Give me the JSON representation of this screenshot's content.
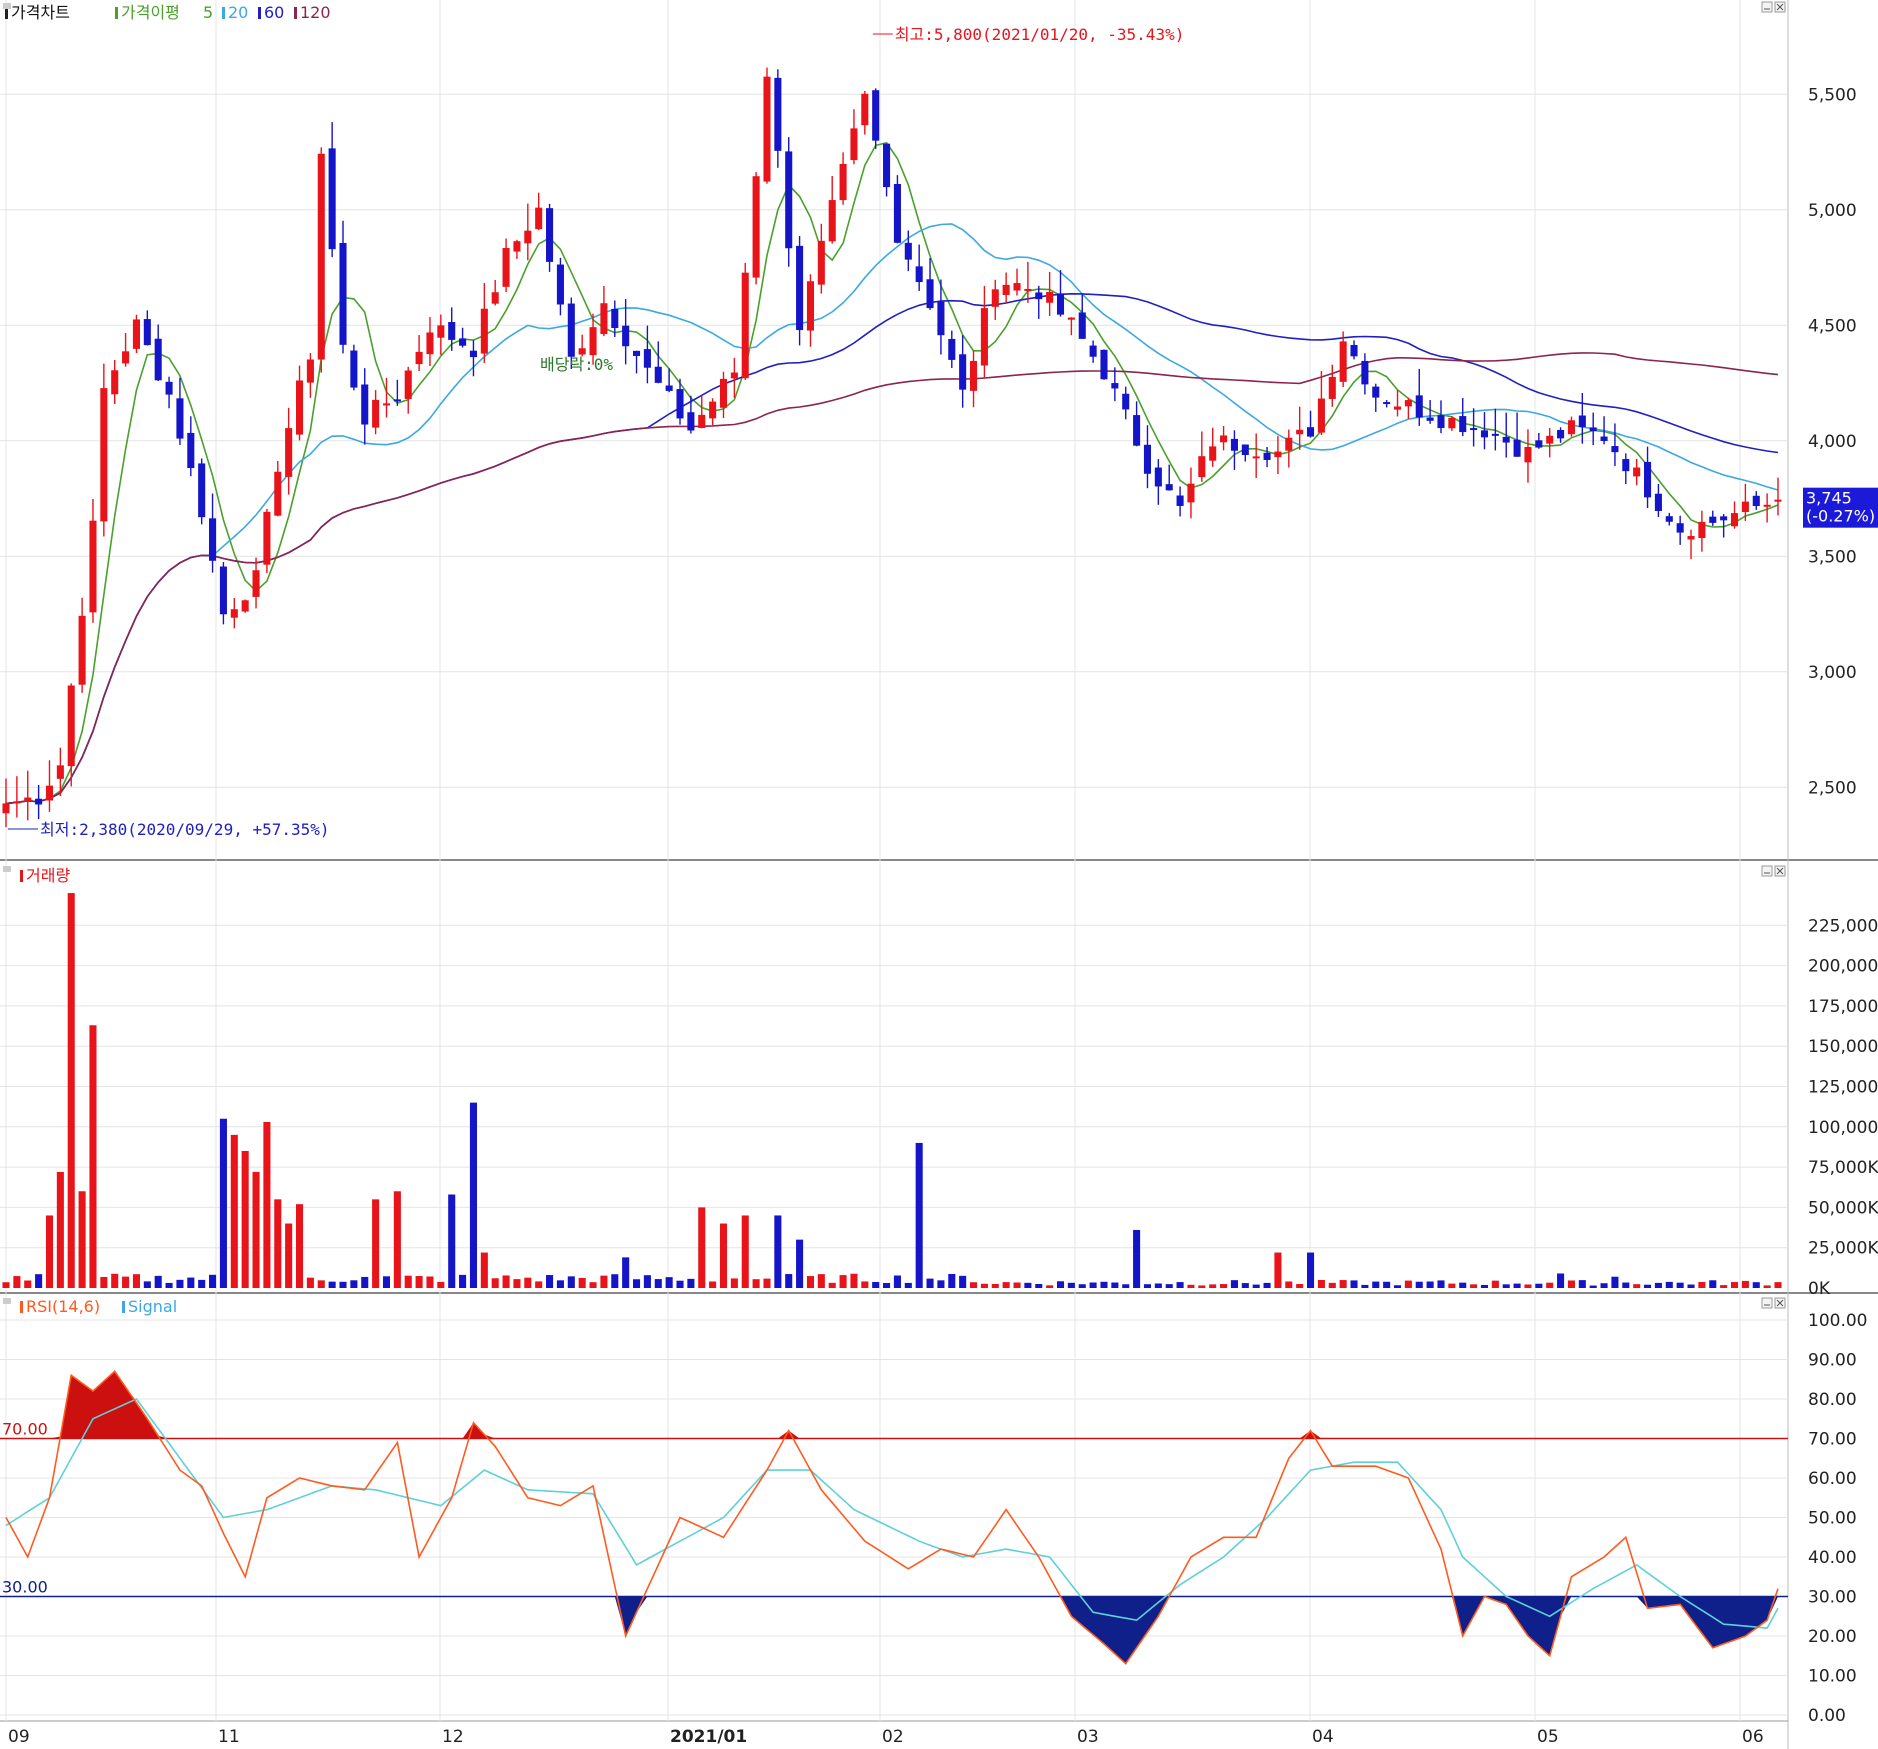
{
  "colors": {
    "up": "#e8141a",
    "down": "#1414c8",
    "ma5": "#4aa02c",
    "ma20": "#3ba9e0",
    "ma60": "#2020c0",
    "ma120": "#8a2550",
    "rsi": "#ff5a1f",
    "signal": "#5fd0d8",
    "overbought": "#cc1010",
    "oversold": "#10208a",
    "grid": "#e4e4e4"
  },
  "price_panel": {
    "title": "가격차트",
    "legend_ma_label": "가격이평",
    "legend_ma": [
      "5",
      "20",
      "60",
      "120"
    ],
    "high_annotation": "최고:5,800(2021/01/20, -35.43%)",
    "low_annotation": "최저:2,380(2020/09/29, +57.35%)",
    "dividend_annotation": "배당락:0%",
    "current_price": "3,745",
    "current_change": "(-0.27%)",
    "y_ticks": [
      "5,500",
      "5,000",
      "4,500",
      "4,000",
      "3,500",
      "3,000",
      "2,500"
    ]
  },
  "volume_panel": {
    "title": "거래량",
    "y_ticks": [
      "225,000K",
      "200,000K",
      "175,000K",
      "150,000K",
      "125,000K",
      "100,000K",
      "75,000K",
      "50,000K",
      "25,000K",
      "0K"
    ]
  },
  "rsi_panel": {
    "title": "RSI(14,6)",
    "signal_label": "Signal",
    "overbought_label": "70.00",
    "oversold_label": "30.00",
    "y_ticks": [
      "100.00",
      "90.00",
      "80.00",
      "70.00",
      "60.00",
      "50.00",
      "40.00",
      "30.00",
      "20.00",
      "10.00",
      "0.00"
    ]
  },
  "x_ticks": [
    "09",
    "11",
    "12",
    "2021/01",
    "02",
    "03",
    "04",
    "05",
    "06"
  ],
  "chart_data": [
    {
      "type": "candlestick",
      "title": "가격차트",
      "ylim": [
        2250,
        5800
      ],
      "price_ticks": [
        5500,
        5000,
        4500,
        4000,
        3500,
        3000,
        2500
      ],
      "moving_averages": [
        "5",
        "20",
        "60",
        "120"
      ],
      "keypoints": [
        [
          0,
          2430
        ],
        [
          3,
          2460
        ],
        [
          5,
          2600
        ],
        [
          8,
          3620
        ],
        [
          9,
          4220
        ],
        [
          12,
          4500
        ],
        [
          15,
          4200
        ],
        [
          18,
          3700
        ],
        [
          20,
          3250
        ],
        [
          23,
          3400
        ],
        [
          25,
          3900
        ],
        [
          28,
          4380
        ],
        [
          29,
          5250
        ],
        [
          31,
          4400
        ],
        [
          33,
          4100
        ],
        [
          36,
          4200
        ],
        [
          39,
          4500
        ],
        [
          43,
          4400
        ],
        [
          46,
          4800
        ],
        [
          49,
          5000
        ],
        [
          52,
          4350
        ],
        [
          55,
          4600
        ],
        [
          59,
          4300
        ],
        [
          63,
          4050
        ],
        [
          67,
          4300
        ],
        [
          70,
          5600
        ],
        [
          73,
          4500
        ],
        [
          76,
          5000
        ],
        [
          79,
          5480
        ],
        [
          82,
          4900
        ],
        [
          85,
          4600
        ],
        [
          88,
          4200
        ],
        [
          91,
          4700
        ],
        [
          95,
          4650
        ],
        [
          98,
          4500
        ],
        [
          101,
          4300
        ],
        [
          105,
          3900
        ],
        [
          108,
          3700
        ],
        [
          111,
          4000
        ],
        [
          114,
          3980
        ],
        [
          117,
          3950
        ],
        [
          120,
          4050
        ],
        [
          123,
          4450
        ],
        [
          126,
          4200
        ],
        [
          129,
          4150
        ],
        [
          132,
          4100
        ],
        [
          136,
          4050
        ],
        [
          140,
          3950
        ],
        [
          144,
          4050
        ],
        [
          147,
          4020
        ],
        [
          150,
          3850
        ],
        [
          154,
          3620
        ],
        [
          157,
          3650
        ],
        [
          160,
          3700
        ],
        [
          163,
          3745
        ]
      ],
      "candle_count": 164,
      "current": 3745,
      "high": {
        "value": 5800,
        "date": "2021/01/20"
      },
      "low": {
        "value": 2380,
        "date": "2020/09/29"
      }
    },
    {
      "type": "bar",
      "title": "거래량",
      "unit": "K",
      "ylim": [
        0,
        250000
      ],
      "spikes": [
        [
          4,
          45000
        ],
        [
          5,
          72000
        ],
        [
          6,
          245000
        ],
        [
          7,
          60000
        ],
        [
          8,
          163000
        ],
        [
          20,
          105000
        ],
        [
          21,
          95000
        ],
        [
          22,
          85000
        ],
        [
          23,
          72000
        ],
        [
          24,
          103000
        ],
        [
          25,
          55000
        ],
        [
          26,
          40000
        ],
        [
          27,
          52000
        ],
        [
          34,
          55000
        ],
        [
          36,
          60000
        ],
        [
          41,
          58000
        ],
        [
          43,
          115000
        ],
        [
          44,
          22000
        ],
        [
          57,
          19000
        ],
        [
          64,
          50000
        ],
        [
          66,
          40000
        ],
        [
          68,
          45000
        ],
        [
          71,
          45000
        ],
        [
          73,
          30000
        ],
        [
          84,
          90000
        ],
        [
          104,
          36000
        ],
        [
          117,
          22000
        ],
        [
          120,
          22000
        ],
        [
          143,
          9000
        ],
        [
          148,
          7000
        ]
      ]
    },
    {
      "type": "line",
      "title": "RSI(14,6)",
      "ylim": [
        0,
        100
      ],
      "reference_lines": [
        70,
        30
      ],
      "series": [
        {
          "name": "RSI(14,6)",
          "keypoints": [
            [
              0,
              50
            ],
            [
              2,
              40
            ],
            [
              4,
              55
            ],
            [
              6,
              86
            ],
            [
              8,
              82
            ],
            [
              10,
              87
            ],
            [
              13,
              75
            ],
            [
              16,
              62
            ],
            [
              18,
              58
            ],
            [
              20,
              46
            ],
            [
              22,
              35
            ],
            [
              24,
              55
            ],
            [
              27,
              60
            ],
            [
              30,
              58
            ],
            [
              33,
              57
            ],
            [
              36,
              69
            ],
            [
              38,
              40
            ],
            [
              41,
              55
            ],
            [
              43,
              74
            ],
            [
              45,
              68
            ],
            [
              48,
              55
            ],
            [
              51,
              53
            ],
            [
              54,
              58
            ],
            [
              57,
              20
            ],
            [
              59,
              32
            ],
            [
              62,
              50
            ],
            [
              66,
              45
            ],
            [
              70,
              62
            ],
            [
              72,
              72
            ],
            [
              75,
              57
            ],
            [
              79,
              44
            ],
            [
              83,
              37
            ],
            [
              86,
              42
            ],
            [
              89,
              40
            ],
            [
              92,
              52
            ],
            [
              95,
              40
            ],
            [
              98,
              25
            ],
            [
              101,
              18
            ],
            [
              103,
              13
            ],
            [
              106,
              25
            ],
            [
              109,
              40
            ],
            [
              112,
              45
            ],
            [
              115,
              45
            ],
            [
              118,
              65
            ],
            [
              120,
              72
            ],
            [
              122,
              63
            ],
            [
              126,
              63
            ],
            [
              129,
              60
            ],
            [
              132,
              42
            ],
            [
              134,
              20
            ],
            [
              136,
              30
            ],
            [
              138,
              28
            ],
            [
              140,
              20
            ],
            [
              142,
              15
            ],
            [
              144,
              35
            ],
            [
              147,
              40
            ],
            [
              149,
              45
            ],
            [
              151,
              27
            ],
            [
              154,
              28
            ],
            [
              157,
              17
            ],
            [
              160,
              20
            ],
            [
              162,
              24
            ],
            [
              164,
              40
            ]
          ]
        },
        {
          "name": "Signal",
          "keypoints": [
            [
              0,
              48
            ],
            [
              4,
              55
            ],
            [
              8,
              75
            ],
            [
              12,
              80
            ],
            [
              16,
              65
            ],
            [
              20,
              50
            ],
            [
              24,
              52
            ],
            [
              30,
              58
            ],
            [
              34,
              57
            ],
            [
              40,
              53
            ],
            [
              44,
              62
            ],
            [
              48,
              57
            ],
            [
              54,
              56
            ],
            [
              58,
              38
            ],
            [
              62,
              44
            ],
            [
              66,
              50
            ],
            [
              70,
              62
            ],
            [
              74,
              62
            ],
            [
              78,
              52
            ],
            [
              84,
              44
            ],
            [
              88,
              40
            ],
            [
              92,
              42
            ],
            [
              96,
              40
            ],
            [
              100,
              26
            ],
            [
              104,
              24
            ],
            [
              108,
              33
            ],
            [
              112,
              40
            ],
            [
              116,
              50
            ],
            [
              120,
              62
            ],
            [
              124,
              64
            ],
            [
              128,
              64
            ],
            [
              132,
              52
            ],
            [
              134,
              40
            ],
            [
              138,
              30
            ],
            [
              142,
              25
            ],
            [
              146,
              32
            ],
            [
              150,
              38
            ],
            [
              154,
              30
            ],
            [
              158,
              23
            ],
            [
              162,
              22
            ],
            [
              164,
              32
            ]
          ]
        }
      ]
    }
  ]
}
